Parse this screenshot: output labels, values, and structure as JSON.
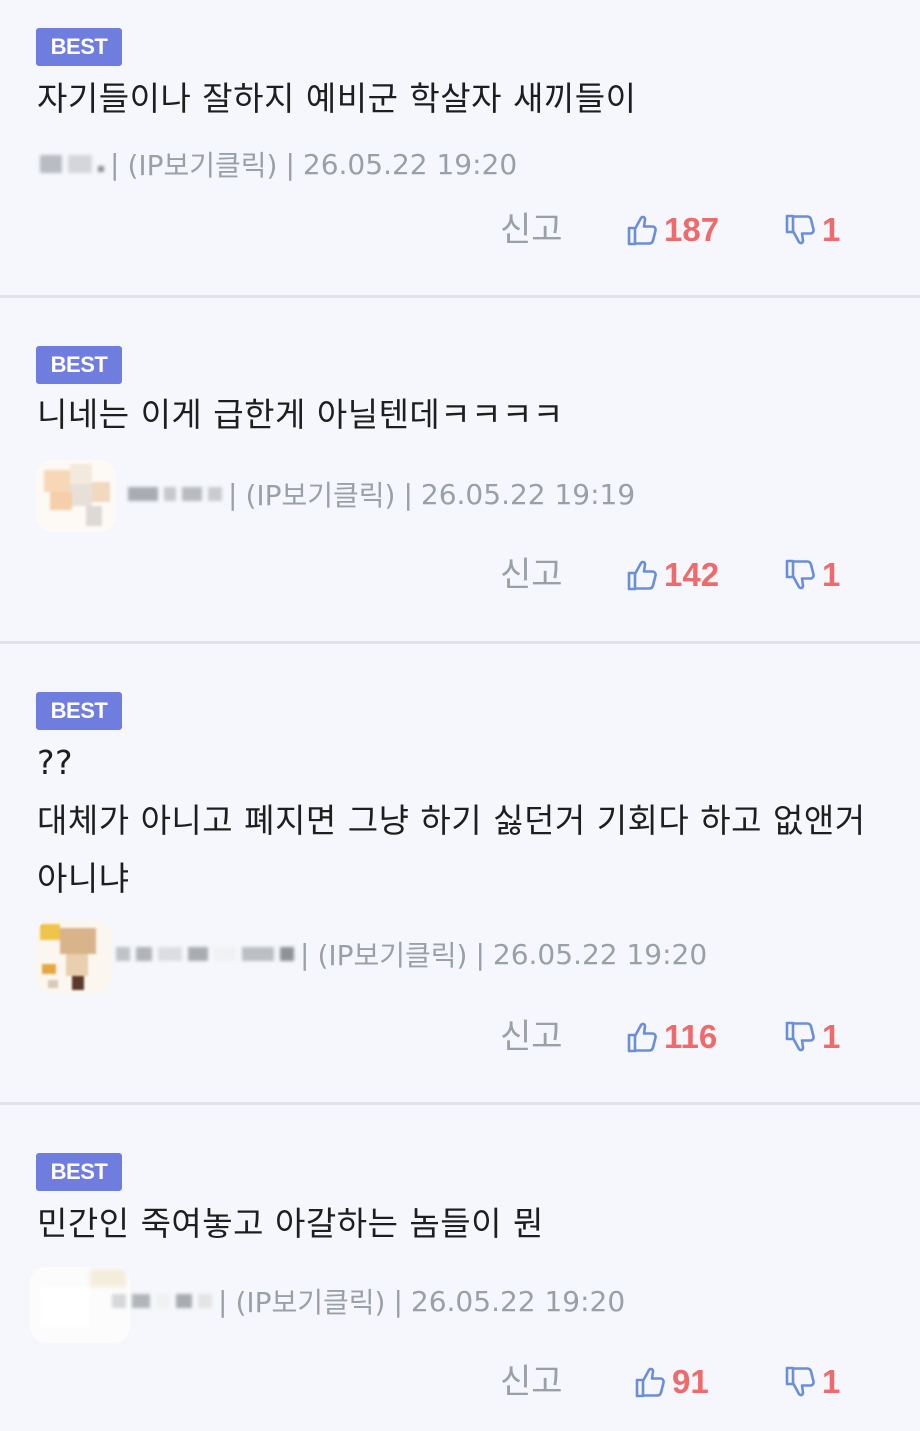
{
  "badge_label": "BEST",
  "report_label": "신고",
  "ip_label": "(IP보기클릭)",
  "separator": "|",
  "comments": [
    {
      "text": "자기들이나 잘하지 예비군 학살자 새끼들이",
      "date": "26.05.22 19:20",
      "likes": "187",
      "dislikes": "1"
    },
    {
      "text": "니네는 이게 급한게 아닐텐데ㅋㅋㅋㅋ",
      "date": "26.05.22 19:19",
      "likes": "142",
      "dislikes": "1"
    },
    {
      "text": "??\n대체가 아니고 폐지면 그냥 하기 싫던거 기회다 하고 없앤거 아니냐",
      "date": "26.05.22 19:20",
      "likes": "116",
      "dislikes": "1"
    },
    {
      "text": "민간인 죽여놓고 아갈하는 놈들이 뭔",
      "date": "26.05.22 19:20",
      "likes": "91",
      "dislikes": "1"
    }
  ]
}
